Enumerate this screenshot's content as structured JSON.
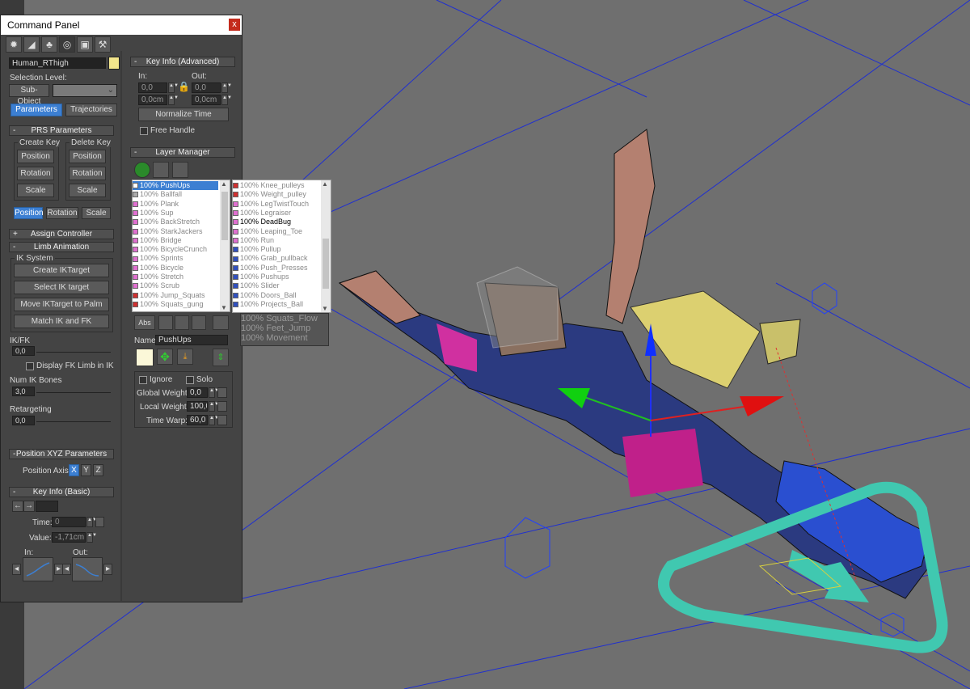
{
  "panel": {
    "title": "Command Panel",
    "close_label": "x",
    "tabs": [
      {
        "icon": "create-sun-icon",
        "glyph": "✹"
      },
      {
        "icon": "modify-icon",
        "glyph": "◢"
      },
      {
        "icon": "hierarchy-icon",
        "glyph": "♣"
      },
      {
        "icon": "motion-icon",
        "glyph": "◎"
      },
      {
        "icon": "display-icon",
        "glyph": "▣"
      },
      {
        "icon": "utilities-icon",
        "glyph": "⚒"
      }
    ],
    "object_name": "Human_RThigh",
    "object_color": "#f2e58c",
    "selection_level_label": "Selection Level:",
    "sub_object_label": "Sub-Object",
    "parameters_label": "Parameters",
    "trajectories_label": "Trajectories",
    "prs": {
      "title": "PRS Parameters",
      "create_key_label": "Create Key",
      "delete_key_label": "Delete Key",
      "position_label": "Position",
      "rotation_label": "Rotation",
      "scale_label": "Scale",
      "bottom_position": "Position",
      "bottom_rotation": "Rotation",
      "bottom_scale": "Scale"
    },
    "assign_controller": "Assign Controller",
    "limb": {
      "title": "Limb Animation",
      "ik_system_label": "IK System",
      "create_iktarget": "Create IKTarget",
      "select_ik_target": "Select IK target",
      "move_iktarget": "Move IKTarget to Palm",
      "match_ik_fk": "Match IK and FK",
      "ikfk_label": "IK/FK",
      "ikfk_value": "0,0",
      "display_fk_label": "Display FK Limb in IK",
      "num_ik_bones_label": "Num IK Bones",
      "num_ik_bones_value": "3,0",
      "retargeting_label": "Retargeting",
      "retargeting_value": "0,0"
    },
    "position_xyz": {
      "title": "Position XYZ Parameters",
      "axis_label": "Position Axis:",
      "x": "X",
      "y": "Y",
      "z": "Z"
    },
    "key_basic": {
      "title": "Key Info (Basic)",
      "time_label": "Time:",
      "time_value": "0",
      "value_label": "Value:",
      "value_value": "-1,71cm",
      "in_label": "In:",
      "out_label": "Out:"
    },
    "key_advanced": {
      "title": "Key Info (Advanced)",
      "in_label": "In:",
      "out_label": "Out:",
      "in_val1": "0,0",
      "in_val2": "0,0cm",
      "out_val1": "0,0",
      "out_val2": "0,0cm",
      "normalize_time": "Normalize Time",
      "free_handle": "Free Handle"
    },
    "layer_manager": {
      "title": "Layer Manager",
      "name_label": "Name:",
      "name_value": "PushUps",
      "abs_label": "Abs",
      "ignore_label": "Ignore",
      "solo_label": "Solo",
      "global_weight_label": "Global Weight:",
      "global_weight_value": "0,0",
      "local_weight_label": "Local Weight:",
      "local_weight_value": "100,0",
      "time_warp_label": "Time Warp:",
      "time_warp_value": "60,0",
      "left_list": [
        {
          "text": "100% PushUps",
          "color": "#ffffff",
          "selected": true
        },
        {
          "text": "100% Ballfall",
          "color": "#aaaaaa"
        },
        {
          "text": "100% Plank",
          "color": "#e070d0"
        },
        {
          "text": "100% Sup",
          "color": "#e070d0"
        },
        {
          "text": "100% BackStretch",
          "color": "#e070d0"
        },
        {
          "text": "100% StarkJackers",
          "color": "#e070d0"
        },
        {
          "text": "100% Bridge",
          "color": "#e070d0"
        },
        {
          "text": "100% BicycleCrunch",
          "color": "#e070d0"
        },
        {
          "text": "100% Sprints",
          "color": "#e070d0"
        },
        {
          "text": "100% Bicycle",
          "color": "#e070d0"
        },
        {
          "text": "100% Stretch",
          "color": "#e070d0"
        },
        {
          "text": "100% Scrub",
          "color": "#e070d0"
        },
        {
          "text": "100% Jump_Squats",
          "color": "#d03030"
        },
        {
          "text": "100% Squats_gung",
          "color": "#d03030"
        }
      ],
      "right_list": [
        {
          "text": "100% Knee_pulleys",
          "color": "#d03030"
        },
        {
          "text": "100% Weight_pulley",
          "color": "#d03030"
        },
        {
          "text": "100% LegTwistTouch",
          "color": "#e070d0"
        },
        {
          "text": "100% Legraiser",
          "color": "#e070d0"
        },
        {
          "text": "100% DeadBug",
          "color": "#e070d0",
          "highlight": true
        },
        {
          "text": "100% Leaping_Toe",
          "color": "#e070d0"
        },
        {
          "text": "100% Run",
          "color": "#e070d0"
        },
        {
          "text": "100% Pullup",
          "color": "#3050c0"
        },
        {
          "text": "100% Grab_pullback",
          "color": "#3050c0"
        },
        {
          "text": "100% Push_Presses",
          "color": "#3050c0"
        },
        {
          "text": "100% Pushups",
          "color": "#3050c0"
        },
        {
          "text": "100% Slider",
          "color": "#3050c0"
        },
        {
          "text": "100% Doors_Ball",
          "color": "#3050c0"
        },
        {
          "text": "100% Projects_Ball",
          "color": "#3050c0"
        },
        {
          "text": "100% Squats_Flow",
          "color": "#3050c0"
        },
        {
          "text": "100% Feet_Jump",
          "color": "#3050c0"
        },
        {
          "text": "100% Movement",
          "color": "#3050c0"
        }
      ]
    }
  },
  "colors": {
    "viewport_bg": "#6f6f6f",
    "grid": "#1f2fd0",
    "panel_bg": "#444444",
    "accent_blue": "#3c7fd2"
  }
}
